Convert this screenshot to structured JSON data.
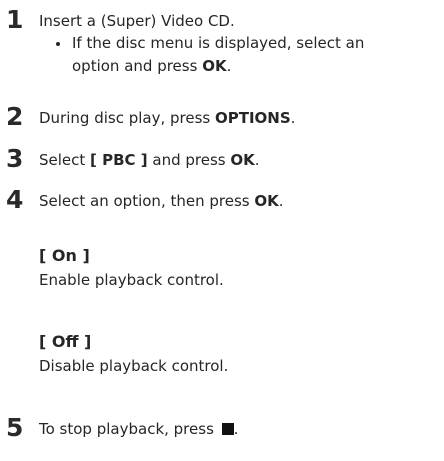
{
  "steps": [
    {
      "number": "1",
      "text": "Insert a (Super) Video CD."
    },
    {
      "number": "2",
      "text_before": "During disc play, press ",
      "key": "OPTIONS",
      "text_after": "."
    },
    {
      "number": "3",
      "text_before": "Select ",
      "key": "[ PBC ]",
      "text_mid": " and press ",
      "key2": "OK",
      "text_after": "."
    },
    {
      "number": "4",
      "text_before": "Select an option, then press ",
      "key": "OK",
      "text_after": "."
    },
    {
      "number": "5",
      "text_before": "To stop playback, press ",
      "text_after": "."
    }
  ],
  "bullet": {
    "line1": "If the disc menu is displayed, select an",
    "line2_before": "option and press ",
    "line2_key": "OK",
    "line2_after": "."
  },
  "options": [
    {
      "title": "[ On ]",
      "description": "Enable playback control."
    },
    {
      "title": "[ Off ]",
      "description": "Disable playback control."
    }
  ],
  "icons": {
    "stop": "stop-square-icon"
  }
}
